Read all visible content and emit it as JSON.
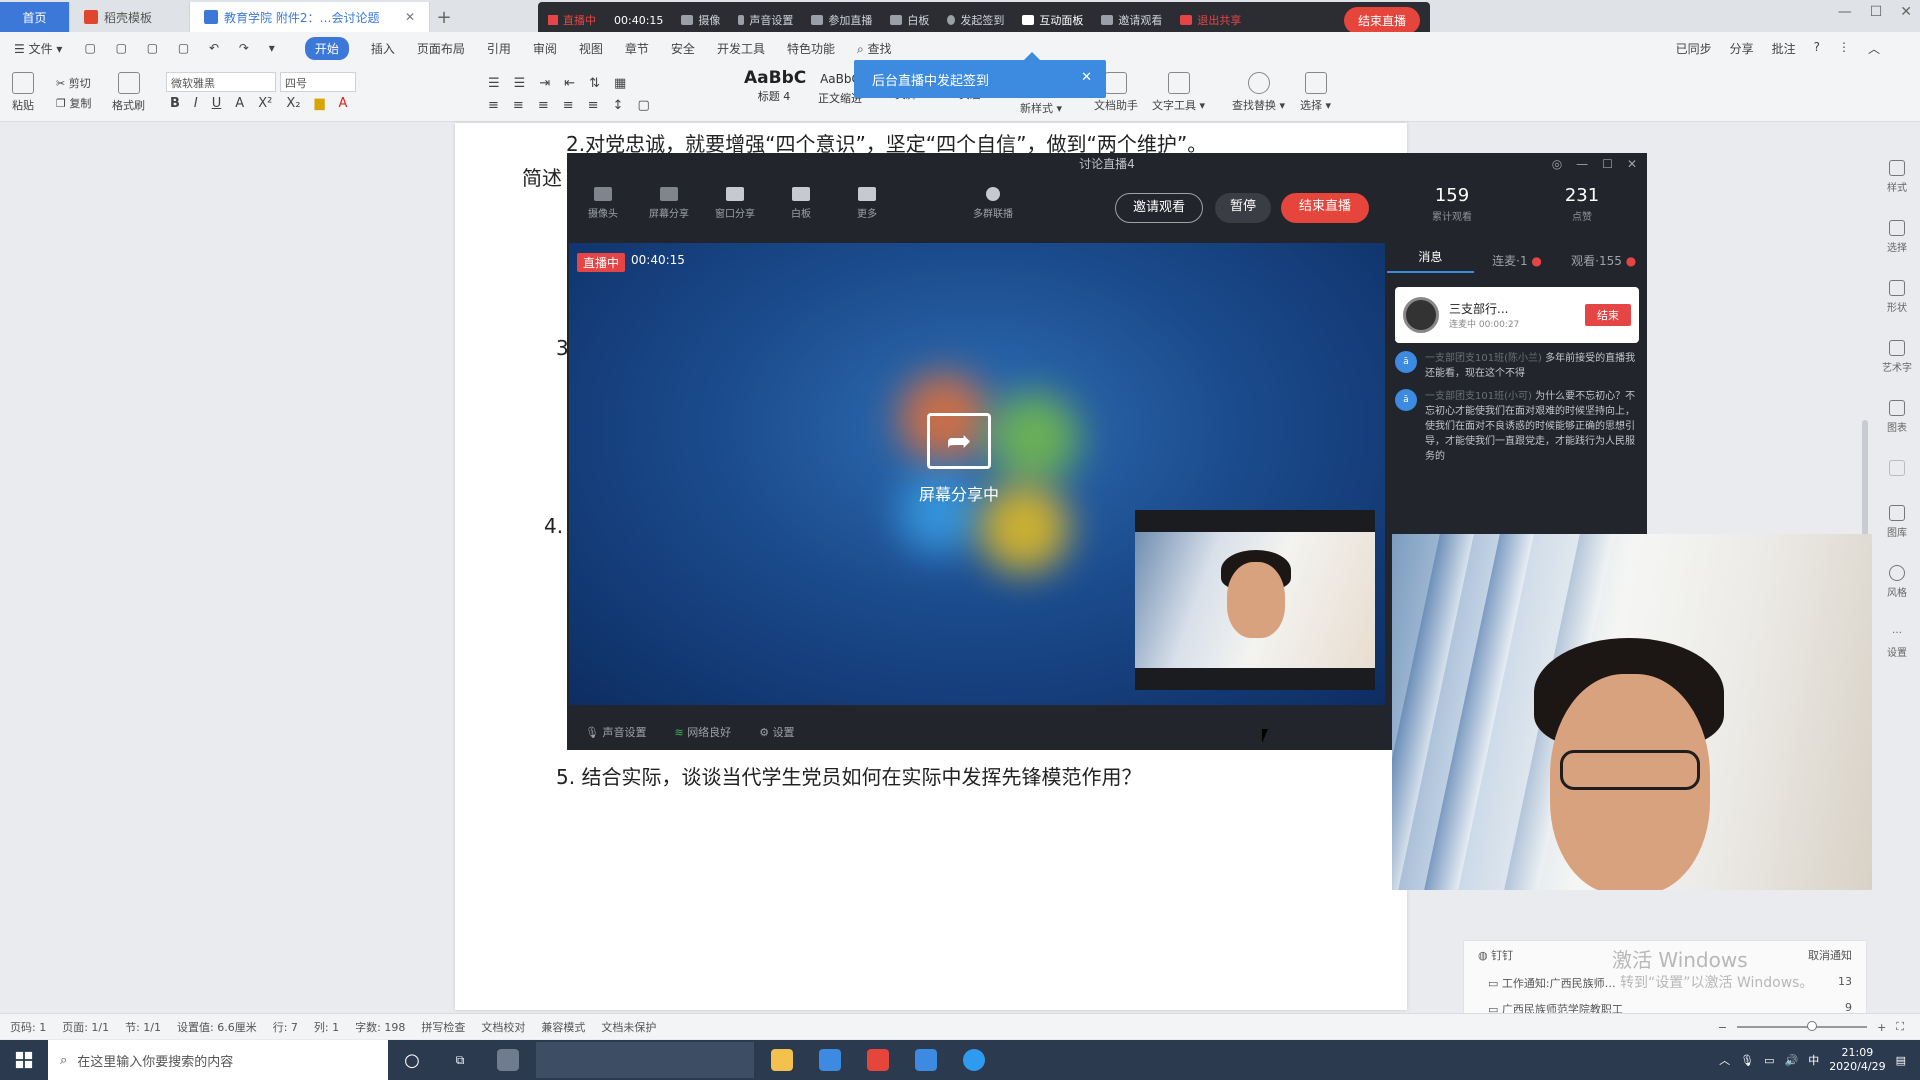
{
  "tabs": [
    {
      "label": "首页"
    },
    {
      "label": "稻壳模板"
    },
    {
      "label": "教育学院 附件2：…会讨论题"
    }
  ],
  "livebar": {
    "status": "直播中",
    "time": "00:40:15",
    "items": [
      "摄像",
      "声音设置",
      "参加直播",
      "白板",
      "发起签到",
      "互动面板",
      "邀请观看",
      "退出共享"
    ],
    "end_label": "结束直播"
  },
  "menu": {
    "file": "文件",
    "items": [
      "开始",
      "插入",
      "页面布局",
      "引用",
      "审阅",
      "视图",
      "章节",
      "安全",
      "开发工具",
      "特色功能",
      "查找"
    ],
    "right": [
      "已同步",
      "分享",
      "批注"
    ]
  },
  "ribbon": {
    "paste": "粘贴",
    "cut": "剪切",
    "copy": "复制",
    "format_painter": "格式刷",
    "font": "微软雅黑",
    "size": "四号",
    "styles": [
      {
        "preview": "AaBbC",
        "name": "标题 4"
      },
      {
        "preview": "AaBbC",
        "name": "正文缩进"
      },
      {
        "preview": "",
        "name": "页脚"
      },
      {
        "preview": "",
        "name": "页眉"
      }
    ],
    "new_style": "新样式",
    "doc_assistant": "文档助手",
    "text_tools": "文字工具",
    "find_replace": "查找替换",
    "select": "选择"
  },
  "notification": "后台直播中发起签到",
  "document": {
    "line1": "2.对党忠诚，就要增强“四个意识”，坚定“四个自信”，做到“两个维护”。",
    "line2": "简述",
    "line3": "3",
    "line4": "4.",
    "line5": "5.  结合实际，谈谈当代学生党员如何在实际中发挥先锋模范作用？"
  },
  "livewin": {
    "title": "讨论直播4",
    "tools": [
      "摄像头",
      "屏幕分享",
      "窗口分享",
      "白板",
      "更多",
      "多群联播"
    ],
    "invite": "邀请观看",
    "pause": "暂停",
    "end": "结束直播",
    "stats": [
      {
        "value": "159",
        "label": "累计观看"
      },
      {
        "value": "231",
        "label": "点赞"
      }
    ],
    "chat_tabs": [
      "消息",
      "连麦·1",
      "观看·155"
    ],
    "live_tag": "直播中",
    "live_time": "00:40:15",
    "sharing": "屏幕分享中",
    "bottom": [
      "声音设置",
      "网络良好",
      "设置"
    ],
    "mic_user": {
      "name": "三支部行...",
      "sub": "连麦中 00:00:27",
      "action": "结束"
    },
    "messages": [
      {
        "who": "一支部团支101班(陈小兰)",
        "text": "多年前接受的直播我还能看，现在这个不得"
      },
      {
        "who": "一支部团支101班(小可)",
        "text": "为什么要不忘初心？不忘初心才能使我们在面对艰难的时候坚持向上，使我们在面对不良诱惑的时候能够正确的思想引导，才能使我们一直跟党走，才能践行为人民服务的"
      }
    ]
  },
  "sidebar": [
    "样式",
    "选择",
    "形状",
    "艺术字",
    "图表",
    "",
    "图库",
    "风格",
    "设置"
  ],
  "ding": {
    "title": "钉钉",
    "action": "取消通知",
    "rows": [
      {
        "text": "工作通知:广西民族师…",
        "count": "13"
      },
      {
        "text": "广西民族师范学院教职工",
        "count": "9"
      }
    ]
  },
  "watermark": {
    "line1": "激活 Windows",
    "line2": "转到“设置”以激活 Windows。"
  },
  "status": [
    "页码: 1",
    "页面: 1/1",
    "节: 1/1",
    "设置值: 6.6厘米",
    "行: 7",
    "列: 1",
    "字数: 198",
    "拼写检查",
    "文档校对",
    "兼容模式",
    "文档未保护"
  ],
  "taskbar": {
    "search_placeholder": "在这里输入你要搜索的内容",
    "time": "21:09",
    "date": "2020/4/29"
  }
}
